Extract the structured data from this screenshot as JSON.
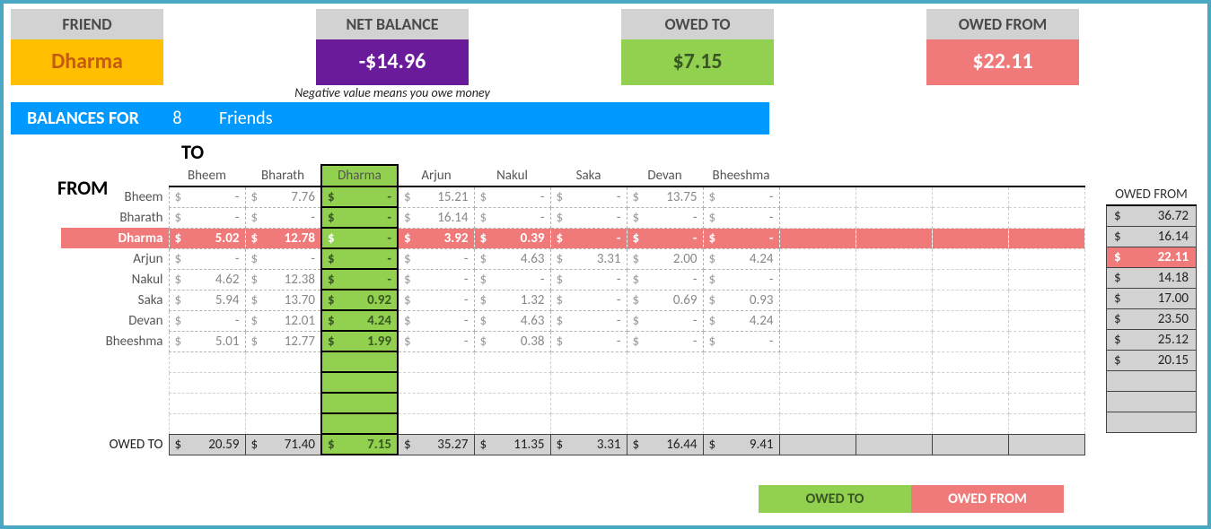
{
  "cards": {
    "friend_label": "FRIEND",
    "friend_value": "Dharma",
    "net_label": "NET BALANCE",
    "net_value": "-$14.96",
    "net_note": "Negative value means you owe money",
    "owedto_label": "OWED TO",
    "owedto_value": "$7.15",
    "owedfrom_label": "OWED FROM",
    "owedfrom_value": "$22.11"
  },
  "balances_bar": {
    "prefix": "BALANCES FOR",
    "count": "8",
    "suffix": "Friends"
  },
  "axis": {
    "to": "TO",
    "from": "FROM"
  },
  "friends": [
    "Bheem",
    "Bharath",
    "Dharma",
    "Arjun",
    "Nakul",
    "Saka",
    "Devan",
    "Bheeshma"
  ],
  "highlight_index": 2,
  "matrix": [
    [
      "-",
      "7.76",
      "-",
      "15.21",
      "-",
      "-",
      "13.75",
      "-"
    ],
    [
      "-",
      "-",
      "-",
      "16.14",
      "-",
      "-",
      "-",
      "-"
    ],
    [
      "5.02",
      "12.78",
      "-",
      "3.92",
      "0.39",
      "-",
      "-",
      "-"
    ],
    [
      "-",
      "-",
      "-",
      "-",
      "4.63",
      "3.31",
      "2.00",
      "4.24"
    ],
    [
      "4.62",
      "12.38",
      "-",
      "-",
      "-",
      "-",
      "-",
      "-"
    ],
    [
      "5.94",
      "13.70",
      "0.92",
      "-",
      "1.32",
      "-",
      "0.69",
      "0.93"
    ],
    [
      "-",
      "12.01",
      "4.24",
      "-",
      "4.63",
      "-",
      "-",
      "4.24"
    ],
    [
      "5.01",
      "12.77",
      "1.99",
      "-",
      "0.38",
      "-",
      "-",
      "-"
    ]
  ],
  "owed_to_row": {
    "label": "OWED TO",
    "values": [
      "20.59",
      "71.40",
      "7.15",
      "35.27",
      "11.35",
      "3.31",
      "16.44",
      "9.41"
    ]
  },
  "owed_from_col": {
    "label": "OWED FROM",
    "values": [
      "36.72",
      "16.14",
      "22.11",
      "14.18",
      "17.00",
      "23.50",
      "25.12",
      "20.15"
    ]
  },
  "legend": {
    "owed_to": "OWED TO",
    "owed_from": "OWED FROM"
  },
  "currency": "$",
  "extra_cols": 4,
  "extra_rows": 4,
  "owedfrom_blank_rows": 3,
  "chart_data": {
    "type": "table",
    "title": "Friend balance matrix (amounts owed FROM row-friend TO column-friend)",
    "row_labels": [
      "Bheem",
      "Bharath",
      "Dharma",
      "Arjun",
      "Nakul",
      "Saka",
      "Devan",
      "Bheeshma"
    ],
    "col_labels": [
      "Bheem",
      "Bharath",
      "Dharma",
      "Arjun",
      "Nakul",
      "Saka",
      "Devan",
      "Bheeshma"
    ],
    "values": [
      [
        null,
        7.76,
        null,
        15.21,
        null,
        null,
        13.75,
        null
      ],
      [
        null,
        null,
        null,
        16.14,
        null,
        null,
        null,
        null
      ],
      [
        5.02,
        12.78,
        null,
        3.92,
        0.39,
        null,
        null,
        null
      ],
      [
        null,
        null,
        null,
        null,
        4.63,
        3.31,
        2.0,
        4.24
      ],
      [
        4.62,
        12.38,
        null,
        null,
        null,
        null,
        null,
        null
      ],
      [
        5.94,
        13.7,
        0.92,
        null,
        1.32,
        null,
        0.69,
        0.93
      ],
      [
        null,
        12.01,
        4.24,
        null,
        4.63,
        null,
        null,
        4.24
      ],
      [
        5.01,
        12.77,
        1.99,
        null,
        0.38,
        null,
        null,
        null
      ]
    ],
    "col_totals_owed_to": [
      20.59,
      71.4,
      7.15,
      35.27,
      11.35,
      3.31,
      16.44,
      9.41
    ],
    "row_totals_owed_from": [
      36.72,
      16.14,
      22.11,
      14.18,
      17.0,
      23.5,
      25.12,
      20.15
    ],
    "selected_friend": "Dharma",
    "net_balance": -14.96,
    "owed_to_selected": 7.15,
    "owed_from_selected": 22.11
  }
}
